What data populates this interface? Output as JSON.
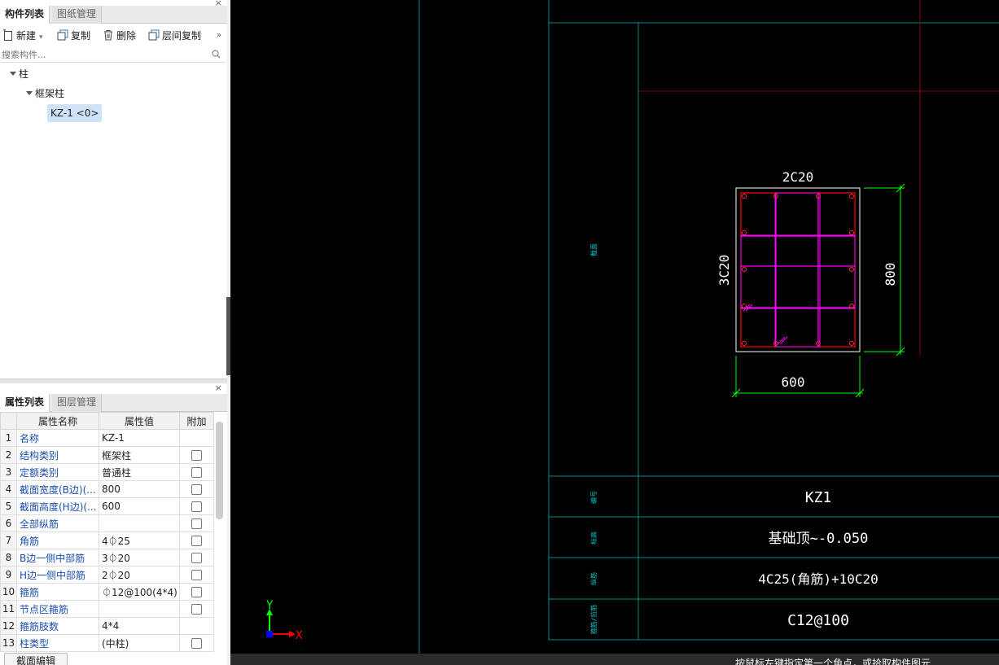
{
  "component_panel": {
    "tabs": [
      "构件列表",
      "图纸管理"
    ],
    "close": "×",
    "toolbar": {
      "new_label": "新建",
      "copy_label": "复制",
      "delete_label": "删除",
      "floor_copy_label": "层间复制",
      "more": "»"
    },
    "search_placeholder": "搜索构件...",
    "tree": {
      "root": "柱",
      "child": "框架柱",
      "selected_item": "KZ-1 <0>"
    }
  },
  "property_panel": {
    "tabs": [
      "属性列表",
      "图层管理"
    ],
    "close": "×",
    "headers": [
      "属性名称",
      "属性值",
      "附加"
    ],
    "rows": [
      {
        "idx": "1",
        "name": "名称",
        "value": "KZ-1",
        "extra": false
      },
      {
        "idx": "2",
        "name": "结构类别",
        "value": "框架柱",
        "extra": true
      },
      {
        "idx": "3",
        "name": "定额类别",
        "value": "普通柱",
        "extra": true
      },
      {
        "idx": "4",
        "name": "截面宽度(B边)(...",
        "value": "800",
        "extra": true
      },
      {
        "idx": "5",
        "name": "截面高度(H边)(...",
        "value": "600",
        "extra": true
      },
      {
        "idx": "6",
        "name": "全部纵筋",
        "value": "",
        "extra": true
      },
      {
        "idx": "7",
        "name": "角筋",
        "value": "4⏀25",
        "extra": true
      },
      {
        "idx": "8",
        "name": "B边一侧中部筋",
        "value": "3⏀20",
        "extra": true
      },
      {
        "idx": "9",
        "name": "H边一侧中部筋",
        "value": "2⏀20",
        "extra": true
      },
      {
        "idx": "10",
        "name": "箍筋",
        "value": "⏀12@100(4*4)",
        "extra": true
      },
      {
        "idx": "11",
        "name": "节点区箍筋",
        "value": "",
        "extra": true
      },
      {
        "idx": "12",
        "name": "箍筋肢数",
        "value": "4*4",
        "extra": false
      },
      {
        "idx": "13",
        "name": "柱类型",
        "value": "(中柱)",
        "extra": true
      }
    ],
    "section_edit_button": "截面编辑"
  },
  "drawing": {
    "top_rebar": "2C20",
    "side_rebar": "3C20",
    "height_dim": "800",
    "width_dim": "600",
    "section_label": "截面",
    "table": [
      {
        "label": "编号",
        "value": "KZ1"
      },
      {
        "label": "标高",
        "value": "基础顶~-0.050"
      },
      {
        "label": "纵筋",
        "value": "4C25(角筋)+10C20"
      },
      {
        "label": "箍筋/拉筋",
        "value": "C12@100"
      }
    ],
    "axis_y": "Y",
    "axis_x": "X",
    "colors": {
      "frame": "#008b8b",
      "red": "#ff0000",
      "magenta": "#ff00ff",
      "green": "#00ff00",
      "darkred": "#8b0000"
    }
  },
  "status": {
    "prompt": "按鼠标左键指定第一个角点，或拾取构件图元"
  }
}
